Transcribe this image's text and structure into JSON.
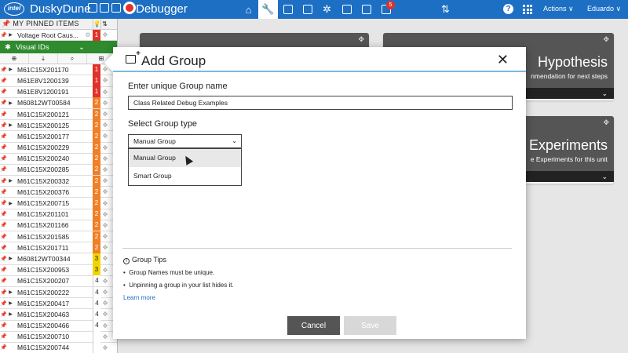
{
  "header": {
    "logo_text": "intel",
    "app_name": "DuskyDune",
    "page_title": "Debugger",
    "notification_count": "5",
    "actions_label": "Actions ∨",
    "user_label": "Eduardo ∨",
    "help_label": "?",
    "nav_icons": [
      "home-icon",
      "wrench-icon",
      "chip-icon",
      "calendar-icon",
      "network-icon",
      "search-doc-icon",
      "clipboard-icon",
      "inbox-icon"
    ]
  },
  "sidebar": {
    "pinned_header": "MY PINNED ITEMS",
    "pinned_items": [
      {
        "name": "Voltage Root Caus...",
        "sev": "1"
      }
    ],
    "visual_ids_label": "Visual IDs",
    "rows": [
      {
        "name": "M61C15X201170",
        "sev": "1",
        "level": "r",
        "expand": true
      },
      {
        "name": "M61E8V1200139",
        "sev": "1",
        "level": "r",
        "expand": false
      },
      {
        "name": "M61E8V1200191",
        "sev": "1",
        "level": "r",
        "expand": false
      },
      {
        "name": "M60812WT00584",
        "sev": "2",
        "level": "o",
        "expand": true
      },
      {
        "name": "M61C15X200121",
        "sev": "2",
        "level": "o",
        "expand": false
      },
      {
        "name": "M61C15X200125",
        "sev": "2",
        "level": "o",
        "expand": true
      },
      {
        "name": "M61C15X200177",
        "sev": "2",
        "level": "o",
        "expand": false
      },
      {
        "name": "M61C15X200229",
        "sev": "2",
        "level": "o",
        "expand": false
      },
      {
        "name": "M61C15X200240",
        "sev": "2",
        "level": "o",
        "expand": false
      },
      {
        "name": "M61C15X200285",
        "sev": "2",
        "level": "o",
        "expand": false
      },
      {
        "name": "M61C15X200332",
        "sev": "2",
        "level": "o",
        "expand": true
      },
      {
        "name": "M61C15X200376",
        "sev": "2",
        "level": "o",
        "expand": false
      },
      {
        "name": "M61C15X200715",
        "sev": "2",
        "level": "o",
        "expand": true
      },
      {
        "name": "M61C15X201101",
        "sev": "2",
        "level": "o",
        "expand": false
      },
      {
        "name": "M61C15X201166",
        "sev": "2",
        "level": "o",
        "expand": false
      },
      {
        "name": "M61C15X201585",
        "sev": "2",
        "level": "o",
        "expand": false
      },
      {
        "name": "M61C15X201711",
        "sev": "2",
        "level": "o",
        "expand": false
      },
      {
        "name": "M60812WT00344",
        "sev": "3",
        "level": "y",
        "expand": true
      },
      {
        "name": "M61C15X200953",
        "sev": "3",
        "level": "y",
        "expand": false
      },
      {
        "name": "M61C15X200207",
        "sev": "4",
        "level": "w",
        "expand": false
      },
      {
        "name": "M61C15X200222",
        "sev": "4",
        "level": "w",
        "expand": true
      },
      {
        "name": "M61C15X200417",
        "sev": "4",
        "level": "w",
        "expand": true
      },
      {
        "name": "M61C15X200463",
        "sev": "4",
        "level": "w",
        "expand": true
      },
      {
        "name": "M61C15X200466",
        "sev": "4",
        "level": "w",
        "expand": false
      },
      {
        "name": "M61C15X200710",
        "sev": "",
        "level": "w",
        "expand": false
      },
      {
        "name": "M61C15X200744",
        "sev": "",
        "level": "w",
        "expand": false
      }
    ]
  },
  "cards": {
    "hypothesis": {
      "title": "Hypothesis",
      "subtitle": "nmendation for next steps"
    },
    "experiments": {
      "title": "Experiments",
      "subtitle": "e Experiments for this unit"
    }
  },
  "dialog": {
    "title": "Add Group",
    "close_label": "✕",
    "name_label": "Enter unique Group name",
    "name_value": "Class Related Debug Examples",
    "type_label": "Select Group type",
    "type_value": "Manual Group",
    "type_options": [
      "Manual Group",
      "Smart Group"
    ],
    "tips_title": "Group Tips",
    "tips": [
      "Group Names must be unique.",
      "Unpinning a group in your list hides it."
    ],
    "learn_more": "Learn more",
    "cancel_label": "Cancel",
    "save_label": "Save"
  },
  "colors": {
    "brand": "#1d6fc4",
    "green": "#2e8b2e",
    "sev1": "#e0322b",
    "sev2": "#f08028",
    "sev3": "#f3d400"
  }
}
